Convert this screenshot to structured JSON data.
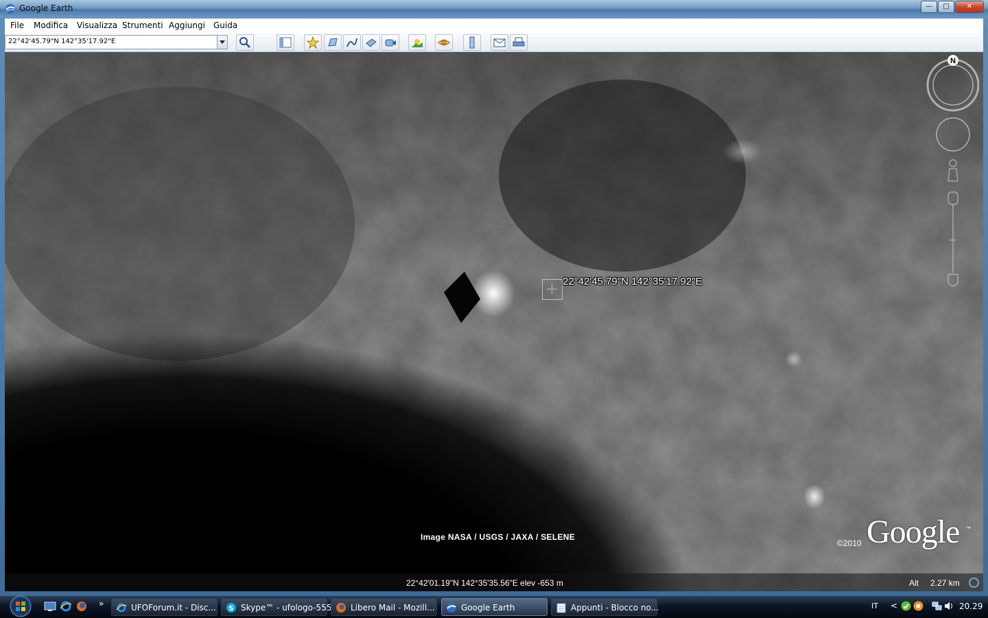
{
  "window": {
    "title": "Google Earth",
    "buttons": {
      "minimize": "—",
      "maximize": "□",
      "close": "✕"
    }
  },
  "menu": {
    "items": [
      "File",
      "Modifica",
      "Visualizza",
      "Strumenti",
      "Aggiungi",
      "Guida"
    ]
  },
  "toolbar": {
    "search_value": "22°42'45.79\"N 142°35'17.92\"E",
    "buttons": [
      "search-icon",
      "sidebar-icon",
      "placemark-icon",
      "polygon-icon",
      "path-icon",
      "image-overlay-icon",
      "record-tour-icon",
      "sun-icon",
      "planets-icon",
      "ruler-icon",
      "email-icon",
      "print-icon"
    ]
  },
  "viewport": {
    "placemark_label": "22°42'45.79\"N 142°35'17.92\"E",
    "credit": "Image NASA / USGS / JAXA / SELENE",
    "copyright": "©2010",
    "logo": "Google",
    "logo_tm": "™",
    "compass_north": "N"
  },
  "status": {
    "coords": "22°42'01.19\"N  142°35'35.56\"E  elev -653 m",
    "alt_label": "Alt",
    "alt_value": "2.27 km"
  },
  "taskbar": {
    "more": "»",
    "tasks": [
      {
        "label": "UFOForum.it - Disc...",
        "icon": "ie-icon",
        "active": false
      },
      {
        "label": "Skype™ - ufologo-555",
        "icon": "skype-icon",
        "active": false
      },
      {
        "label": "Libero Mail - Mozill...",
        "icon": "firefox-icon",
        "active": false
      },
      {
        "label": "Google Earth",
        "icon": "google-earth-icon",
        "active": true
      },
      {
        "label": "Appunti - Blocco no...",
        "icon": "notepad-icon",
        "active": false
      }
    ],
    "language": "IT",
    "tray_arrow": "<",
    "clock": "20.29"
  },
  "colors": {
    "title_bar": "#6f9ac2",
    "taskbar": "#0c1626",
    "accent": "#6ea7d8"
  }
}
